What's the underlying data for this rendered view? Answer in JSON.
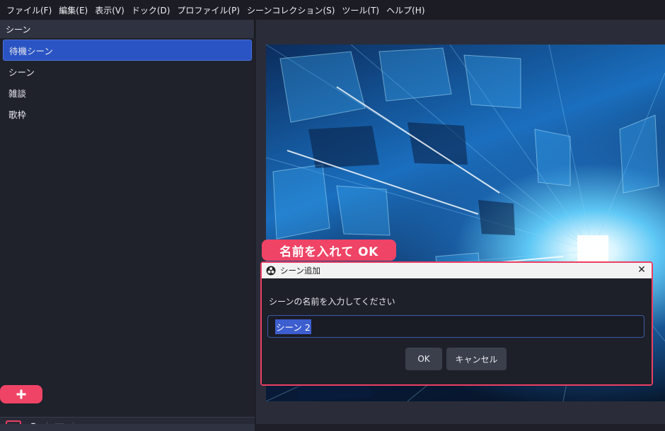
{
  "menubar": {
    "items": [
      "ファイル(F)",
      "編集(E)",
      "表示(V)",
      "ドック(D)",
      "プロファイル(P)",
      "シーンコレクション(S)",
      "ツール(T)",
      "ヘルプ(H)"
    ]
  },
  "scenes": {
    "header": "シーン",
    "items": [
      {
        "label": "待機シーン",
        "selected": true
      },
      {
        "label": "シーン",
        "selected": false
      },
      {
        "label": "雑談",
        "selected": false
      },
      {
        "label": "歌枠",
        "selected": false
      }
    ]
  },
  "toolbar": {
    "icons": [
      "plus-icon",
      "trash-icon",
      "filter-icon",
      "chevron-up-icon",
      "chevron-down-icon"
    ]
  },
  "annotations": {
    "plus_badge": "+",
    "callout": "名前を入れて OK"
  },
  "dialog": {
    "title": "シーン追加",
    "prompt": "シーンの名前を入力してください",
    "input_value": "シーン 2",
    "ok_label": "OK",
    "cancel_label": "キャンセル",
    "close_glyph": "✕"
  },
  "colors": {
    "accent": "#ef4466",
    "selection": "#2a54c4",
    "background": "#1e1f29"
  }
}
